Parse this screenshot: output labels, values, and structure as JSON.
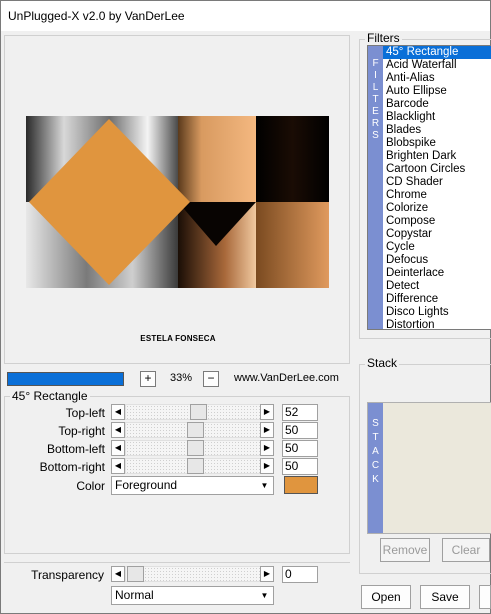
{
  "window": {
    "title": "UnPlugged-X v2.0 by VanDerLee"
  },
  "preview": {
    "credit_text": "ESTELA FONSECA"
  },
  "zoom": {
    "plus": "+",
    "minus": "−",
    "value": "33%",
    "url": "www.VanDerLee.com"
  },
  "params": {
    "group_title": "45° Rectangle",
    "sliders": [
      {
        "label": "Top-left",
        "value": "52",
        "level": 0.52
      },
      {
        "label": "Top-right",
        "value": "50",
        "level": 0.5
      },
      {
        "label": "Bottom-left",
        "value": "50",
        "level": 0.5
      },
      {
        "label": "Bottom-right",
        "value": "50",
        "level": 0.5
      }
    ],
    "color_label": "Color",
    "color_select": "Foreground",
    "color_swatch": "#e0953e"
  },
  "transparency": {
    "label": "Transparency",
    "value": "0",
    "level": 0,
    "blend_select": "Normal"
  },
  "filters": {
    "title": "Filters",
    "tab_letters": [
      "F",
      "I",
      "L",
      "T",
      "E",
      "R",
      "S"
    ],
    "items": [
      "45° Rectangle",
      "Acid Waterfall",
      "Anti-Alias",
      "Auto Ellipse",
      "Barcode",
      "Blacklight",
      "Blades",
      "Blobspike",
      "Brighten Dark",
      "Cartoon Circles",
      "CD Shader",
      "Chrome",
      "Colorize",
      "Compose",
      "Copystar",
      "Cycle",
      "Defocus",
      "Deinterlace",
      "Detect",
      "Difference",
      "Disco Lights",
      "Distortion"
    ],
    "selected_index": 0
  },
  "stack": {
    "title": "Stack",
    "tab_letters": [
      "S",
      "T",
      "A",
      "C",
      "K"
    ],
    "remove": "Remove",
    "clear": "Clear"
  },
  "buttons": {
    "open": "Open",
    "save": "Save"
  },
  "colors": {
    "accent": "#0a6fd8",
    "tab": "#7b8fd1",
    "stack_bg": "#ebe8dc"
  }
}
